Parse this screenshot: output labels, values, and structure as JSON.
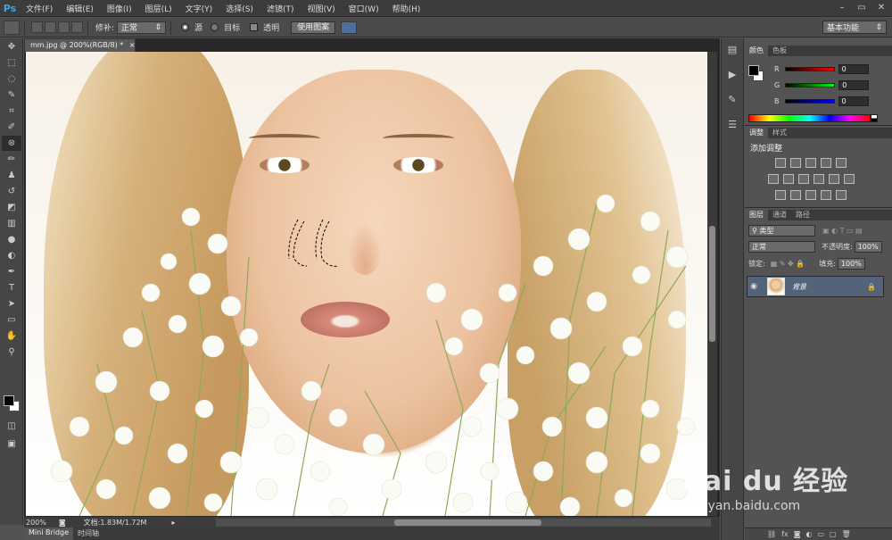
{
  "app": {
    "logo": "Ps"
  },
  "menu": [
    "文件(F)",
    "编辑(E)",
    "图像(I)",
    "图层(L)",
    "文字(Y)",
    "选择(S)",
    "滤镜(T)",
    "视图(V)",
    "窗口(W)",
    "帮助(H)"
  ],
  "window_controls": {
    "minimize": "–",
    "restore": "▭",
    "close": "✕"
  },
  "options": {
    "repair_label": "修补:",
    "repair_value": "正常",
    "source_label": "源",
    "target_label": "目标",
    "transparent_label": "透明",
    "use_pattern_button": "使用图案",
    "workspace_value": "基本功能"
  },
  "document": {
    "tab_title": "mm.jpg @ 200%(RGB/8) *",
    "tab_close": "×",
    "zoom": "200%",
    "doc_info": "文档:1.83M/1.72M"
  },
  "bottom_tabs": [
    "Mini Bridge",
    "时间轴"
  ],
  "color_panel": {
    "tabs": [
      "颜色",
      "色板"
    ],
    "r_label": "R",
    "r_value": "0",
    "g_label": "G",
    "g_value": "0",
    "b_label": "B",
    "b_value": "0"
  },
  "adjust_panel": {
    "tabs": [
      "调整",
      "样式"
    ],
    "title": "添加调整"
  },
  "layers_panel": {
    "tabs": [
      "图层",
      "通道",
      "路径"
    ],
    "kind_filter": "类型",
    "blend_mode": "正常",
    "opacity_label": "不透明度:",
    "opacity_value": "100%",
    "lock_label": "锁定:",
    "fill_label": "填充:",
    "fill_value": "100%",
    "layer_name": "背景"
  },
  "colors": {
    "accent": "#3ea6e6",
    "selected_layer": "#55637a",
    "panel_bg": "#535353"
  },
  "watermark": {
    "brand": "Bai du 经验",
    "url": "jingyan.baidu.com"
  }
}
